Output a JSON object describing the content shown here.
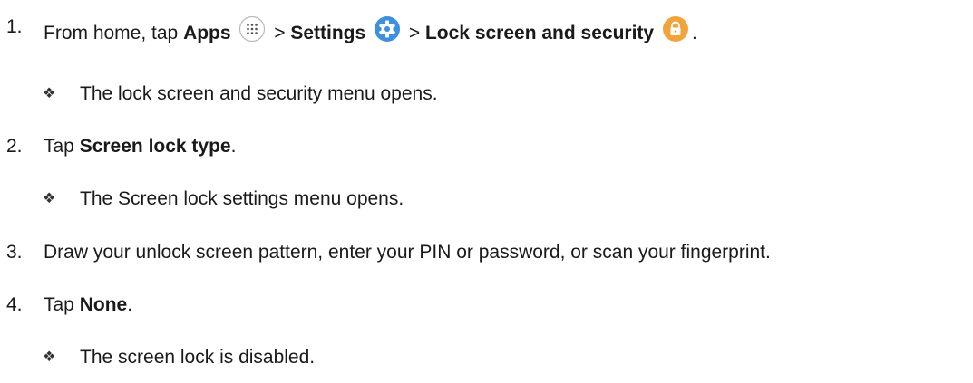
{
  "steps": [
    {
      "number": "1.",
      "segments": {
        "t1": "From home, tap ",
        "apps": "Apps",
        "sep1": " > ",
        "settings": "Settings",
        "sep2": " > ",
        "lock": "Lock screen and security",
        "end": "."
      },
      "result": "The lock screen and security menu opens."
    },
    {
      "number": "2.",
      "segments": {
        "t1": "Tap ",
        "bold": "Screen lock type",
        "end": "."
      },
      "result": "The Screen lock settings menu opens."
    },
    {
      "number": "3.",
      "text": "Draw your unlock screen pattern, enter your PIN or password, or scan your fingerprint."
    },
    {
      "number": "4.",
      "segments": {
        "t1": "Tap ",
        "bold": "None",
        "end": "."
      },
      "result": "The screen lock is disabled."
    }
  ],
  "bullet_glyph": "❖",
  "icons": {
    "apps": "apps-grid-icon",
    "settings": "settings-gear-icon",
    "lock": "lock-icon"
  },
  "colors": {
    "settings": "#3f8fe0",
    "lock": "#f2a43a"
  }
}
